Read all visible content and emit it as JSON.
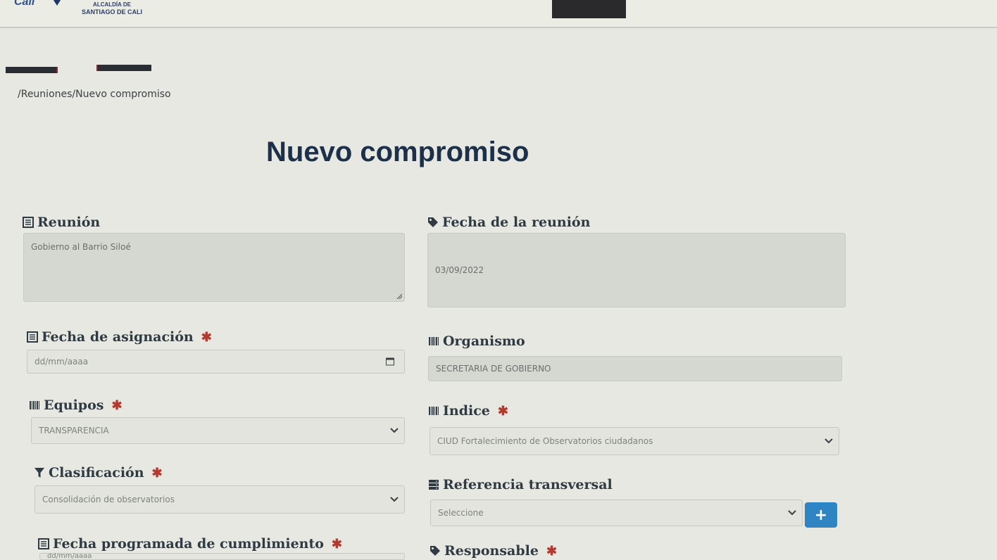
{
  "header": {
    "logo_text": "Cali",
    "org_line1": "ALCALDÍA DE",
    "org_line2": "SANTIAGO DE CALI"
  },
  "breadcrumb": "/Reuniones/Nuevo compromiso",
  "page_title": "Nuevo compromiso",
  "required_marker": "✱",
  "form": {
    "reunion": {
      "label": "Reunión",
      "value": "Gobierno al Barrio Siloé"
    },
    "fecha_reunion": {
      "label": "Fecha de la reunión",
      "value": "03/09/2022"
    },
    "fecha_asignacion": {
      "label": "Fecha de asignación",
      "placeholder": "dd/mm/aaaa"
    },
    "organismo": {
      "label": "Organismo",
      "value": "SECRETARIA DE GOBIERNO"
    },
    "equipos": {
      "label": "Equipos",
      "selected": "TRANSPARENCIA"
    },
    "indice": {
      "label": "Indice",
      "selected": "CIUD Fortalecimiento de Observatorios ciudadanos"
    },
    "clasificacion": {
      "label": "Clasificación",
      "selected": "Consolidación de observatorios"
    },
    "referencia_transversal": {
      "label": "Referencia transversal",
      "selected": "Seleccione",
      "add_button": "+"
    },
    "fecha_programada": {
      "label": "Fecha programada de cumplimiento",
      "placeholder": "dd/mm/aaaa"
    },
    "responsable": {
      "label": "Responsable"
    }
  },
  "colors": {
    "title": "#1c3049",
    "required": "#b23a30",
    "button": "#2f84c3"
  }
}
